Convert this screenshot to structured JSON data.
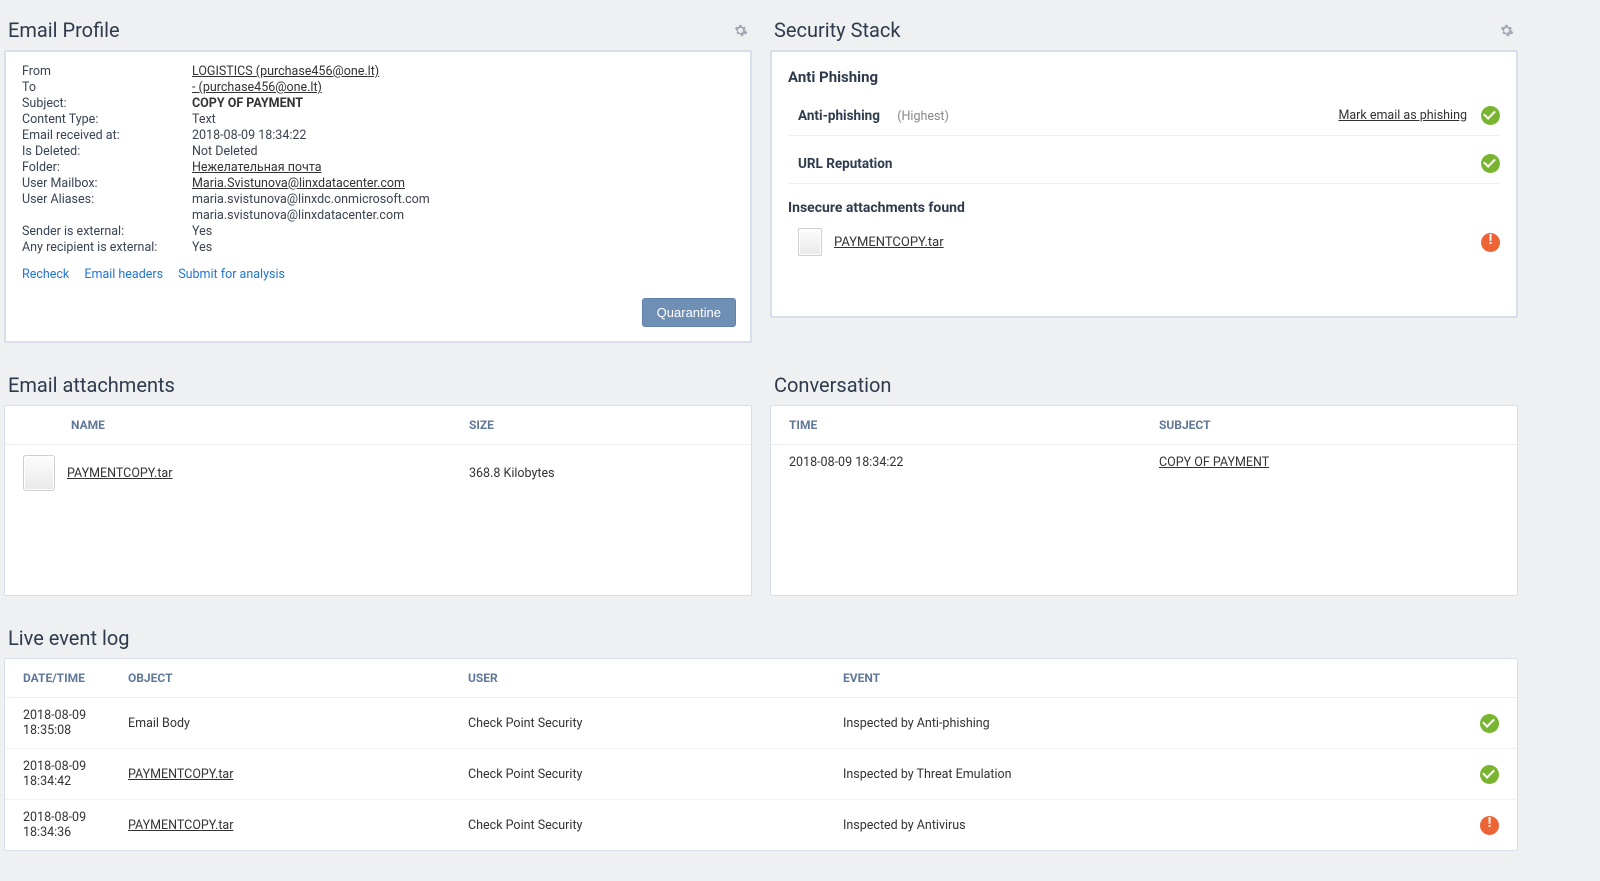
{
  "emailProfile": {
    "title": "Email Profile",
    "fields": {
      "from_label": "From",
      "from_value": "LOGISTICS (purchase456@one.lt)",
      "to_label": "To",
      "to_value": "- (purchase456@one.lt)",
      "subject_label": "Subject:",
      "subject_value": "COPY OF PAYMENT",
      "ctype_label": "Content Type:",
      "ctype_value": "Text",
      "recv_label": "Email received at:",
      "recv_value": "2018-08-09 18:34:22",
      "del_label": "Is Deleted:",
      "del_value": "Not Deleted",
      "folder_label": "Folder:",
      "folder_value": "Нежелательная почта",
      "mailbox_label": "User Mailbox:",
      "mailbox_value": "Maria.Svistunova@linxdatacenter.com",
      "alias_label": "User Aliases:",
      "alias1": "maria.svistunova@linxdc.onmicrosoft.com",
      "alias2": "maria.svistunova@linxdatacenter.com",
      "sender_ext_label": "Sender is external:",
      "sender_ext_value": "Yes",
      "recip_ext_label": "Any recipient is external:",
      "recip_ext_value": "Yes"
    },
    "actions": {
      "recheck": "Recheck",
      "headers": "Email headers",
      "submit": "Submit for analysis"
    },
    "quarantine": "Quarantine"
  },
  "securityStack": {
    "title": "Security Stack",
    "antiphish_title": "Anti Phishing",
    "antiphish_name": "Anti-phishing",
    "antiphish_level": "(Highest)",
    "antiphish_action": "Mark email as phishing",
    "urlrep_name": "URL Reputation",
    "insecure_title": "Insecure attachments found",
    "insecure_file": "PAYMENTCOPY.tar"
  },
  "attachments": {
    "title": "Email attachments",
    "head_name": "NAME",
    "head_size": "SIZE",
    "rows": [
      {
        "name": "PAYMENTCOPY.tar",
        "size": "368.8 Kilobytes"
      }
    ]
  },
  "conversation": {
    "title": "Conversation",
    "head_time": "TIME",
    "head_subject": "SUBJECT",
    "rows": [
      {
        "time": "2018-08-09 18:34:22",
        "subject": "COPY OF PAYMENT"
      }
    ]
  },
  "eventlog": {
    "title": "Live event log",
    "head_dt": "DATE/TIME",
    "head_obj": "OBJECT",
    "head_usr": "USER",
    "head_evt": "EVENT",
    "rows": [
      {
        "dt1": "2018-08-09",
        "dt2": "18:35:08",
        "obj": "Email Body",
        "obj_link": false,
        "usr": "Check Point Security",
        "evt": "Inspected by Anti-phishing",
        "status": "ok"
      },
      {
        "dt1": "2018-08-09",
        "dt2": "18:34:42",
        "obj": "PAYMENTCOPY.tar",
        "obj_link": true,
        "usr": "Check Point Security",
        "evt": "Inspected by Threat Emulation",
        "status": "ok"
      },
      {
        "dt1": "2018-08-09",
        "dt2": "18:34:36",
        "obj": "PAYMENTCOPY.tar",
        "obj_link": true,
        "usr": "Check Point Security",
        "evt": "Inspected by Antivirus",
        "status": "warn"
      }
    ]
  }
}
